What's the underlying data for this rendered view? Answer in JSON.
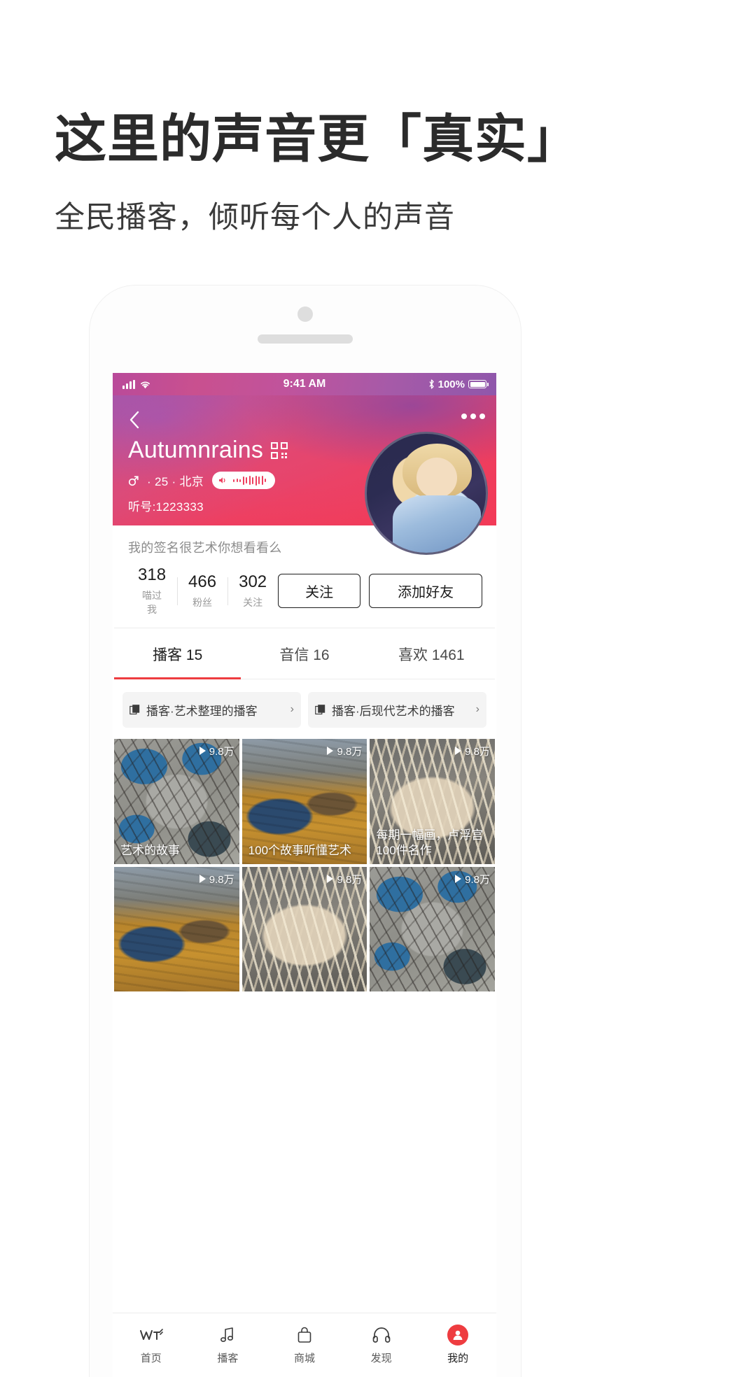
{
  "promo": {
    "title": "这里的声音更「真实」",
    "subtitle": "全民播客，倾听每个人的声音"
  },
  "statusbar": {
    "time": "9:41 AM",
    "battery": "100%",
    "signal_icon": "cellular-bars-icon",
    "wifi_icon": "wifi-icon",
    "bluetooth_icon": "bluetooth-icon"
  },
  "hero": {
    "back_icon": "back-chevron-icon",
    "more_icon": "more-dots-icon",
    "username": "Autumnrains",
    "qr_icon": "qr-code-icon",
    "gender_icon": "male-gender-icon",
    "meta": "· 25 · 北京",
    "voice_icon": "speaker-icon",
    "user_id": "听号:1223333",
    "avatar_name": "user-avatar"
  },
  "profile": {
    "signature": "我的签名很艺术你想看看么",
    "stats": [
      {
        "value": "318",
        "label": "喵过我"
      },
      {
        "value": "466",
        "label": "粉丝"
      },
      {
        "value": "302",
        "label": "关注"
      }
    ],
    "follow_label": "关注",
    "add_friend_label": "添加好友"
  },
  "tabs": [
    {
      "label": "播客 15",
      "active": true
    },
    {
      "label": "音信 16",
      "active": false
    },
    {
      "label": "喜欢 1461",
      "active": false
    }
  ],
  "chips": [
    {
      "icon": "collection-icon",
      "label": "播客·艺术整理的播客",
      "arrow": "›"
    },
    {
      "icon": "collection-icon",
      "label": "播客·后现代艺术的播客",
      "arrow": "›"
    }
  ],
  "grid": [
    {
      "plays": "9.8万",
      "caption": "艺术的故事",
      "art": "art-squirrel"
    },
    {
      "plays": "9.8万",
      "caption": "100个故事听懂艺术",
      "art": "art-landscape"
    },
    {
      "plays": "9.8万",
      "caption": "每期一幅画，卢浮宫100件名作",
      "art": "art-basket"
    },
    {
      "plays": "9.8万",
      "caption": "",
      "art": "art-landscape"
    },
    {
      "plays": "9.8万",
      "caption": "",
      "art": "art-basket"
    },
    {
      "plays": "9.8万",
      "caption": "",
      "art": "art-squirrel"
    }
  ],
  "bottomnav": [
    {
      "label": "首页",
      "icon": "home-logo-icon",
      "active": false
    },
    {
      "label": "播客",
      "icon": "music-note-icon",
      "active": false
    },
    {
      "label": "商城",
      "icon": "shopping-bag-icon",
      "active": false
    },
    {
      "label": "发现",
      "icon": "headphones-icon",
      "active": false
    },
    {
      "label": "我的",
      "icon": "profile-avatar-icon",
      "active": true
    }
  ],
  "colors": {
    "accent_red": "#ee3c40",
    "hero_pink": "#ef3e5f",
    "hero_purple": "#b0539f"
  }
}
